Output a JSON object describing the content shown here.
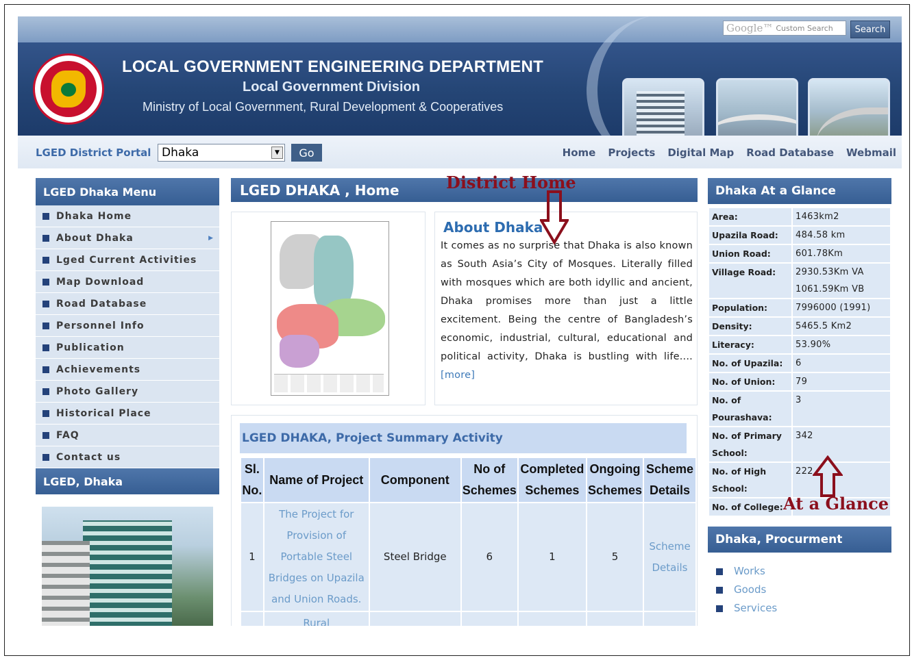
{
  "search": {
    "brand": "Google™",
    "placeholder": "Custom Search",
    "button": "Search"
  },
  "header": {
    "title": "LOCAL GOVERNMENT ENGINEERING DEPARTMENT",
    "division": "Local Government Division",
    "ministry": "Ministry of Local Government, Rural Development & Cooperatives"
  },
  "portal": {
    "label": "LGED District Portal",
    "selected": "Dhaka",
    "go": "Go"
  },
  "topnav": [
    "Home",
    "Projects",
    "Digital Map",
    "Road Database",
    "Webmail"
  ],
  "leftmenu": {
    "title": "LGED Dhaka Menu",
    "items": [
      "Dhaka Home",
      "About Dhaka",
      "Lged Current Activities",
      "Map Download",
      "Road Database",
      "Personnel Info",
      "Publication",
      "Achievements",
      "Photo Gallery",
      "Historical Place",
      "FAQ",
      "Contact us"
    ]
  },
  "lgedbox": {
    "title": "LGED, Dhaka"
  },
  "center": {
    "title": "LGED DHAKA , Home",
    "about_title": "About Dhaka",
    "about_text": "It comes as no surprise that Dhaka is also known as South Asia’s City of Mosques. Literally filled with mosques which are both idyllic and ancient, Dhaka promises more than just a little excitement. Being the centre of Bangladesh’s economic, industrial, cultural, educational and political activity, Dhaka is bustling with life....",
    "more": "[more]"
  },
  "annotations": {
    "district_home": "District Home",
    "at_a_glance": "At a Glance",
    "color": "#8b0f1c"
  },
  "project": {
    "title": "LGED DHAKA, Project Summary Activity",
    "headers": [
      "Sl. No.",
      "Name of Project",
      "Component",
      "No of Schemes",
      "Completed Schemes",
      "Ongoing Schemes",
      "Scheme Details"
    ],
    "rows": [
      [
        "1",
        "The Project for Provision of Portable Steel Bridges on Upazila and Union Roads.",
        "Steel Bridge",
        "6",
        "1",
        "5",
        "Scheme Details"
      ]
    ],
    "next_row_partial": "Rural"
  },
  "glance": {
    "title": "Dhaka At a Glance",
    "rows": [
      [
        "Area:",
        "1463km2"
      ],
      [
        "Upazila Road:",
        "484.58 km"
      ],
      [
        "Union Road:",
        "601.78Km"
      ],
      [
        "Village Road:",
        "2930.53Km VA 1061.59Km VB"
      ],
      [
        "Population:",
        "7996000 (1991)"
      ],
      [
        "Density:",
        "5465.5 Km2"
      ],
      [
        "Literacy:",
        "53.90%"
      ],
      [
        "No. of Upazila:",
        "6"
      ],
      [
        "No. of Union:",
        "79"
      ],
      [
        "No. of Pourashava:",
        "3"
      ],
      [
        "No. of Primary School:",
        "342"
      ],
      [
        "No. of High School:",
        "222"
      ],
      [
        "No. of College:",
        ""
      ]
    ]
  },
  "procurement": {
    "title": "Dhaka, Procurment",
    "items": [
      "Works",
      "Goods",
      "Services"
    ]
  },
  "colors": {
    "header_blue": "#254676",
    "box_head": "#4f76aa",
    "cell_bg": "#dde8f5",
    "link": "#3d79b8"
  }
}
